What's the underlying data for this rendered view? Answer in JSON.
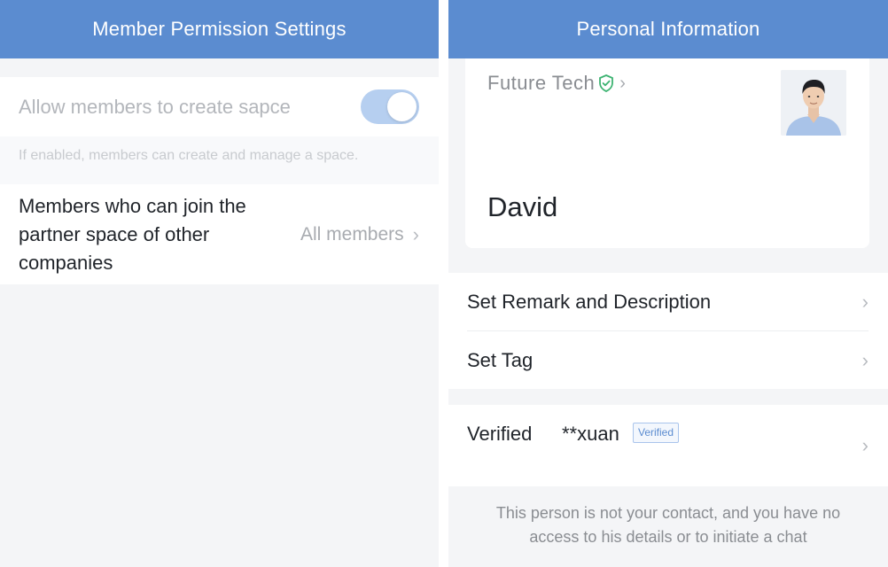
{
  "left": {
    "title": "Member Permission Settings",
    "create_space": {
      "label": "Allow members to create sapce",
      "enabled": true,
      "hint": "If enabled, members can create and manage a space."
    },
    "partner_space": {
      "label": "Members who can join the partner space of other companies",
      "value": "All members"
    }
  },
  "right": {
    "title": "Personal Information",
    "company": "Future Tech",
    "name": "David",
    "menu": [
      {
        "label": "Set Remark and Description"
      },
      {
        "label": "Set Tag"
      }
    ],
    "verified": {
      "label": "Verified",
      "name": "**xuan",
      "badge": "Verified"
    },
    "notice": "This person is not your contact, and you have no access to his details or to initiate a chat"
  },
  "colors": {
    "header": "#5b8cd0",
    "toggle_on": "#b6cff0",
    "verified_icon": "#3cb371"
  },
  "icons": [
    "verified-shield-icon",
    "chevron-right-icon",
    "avatar-photo"
  ]
}
